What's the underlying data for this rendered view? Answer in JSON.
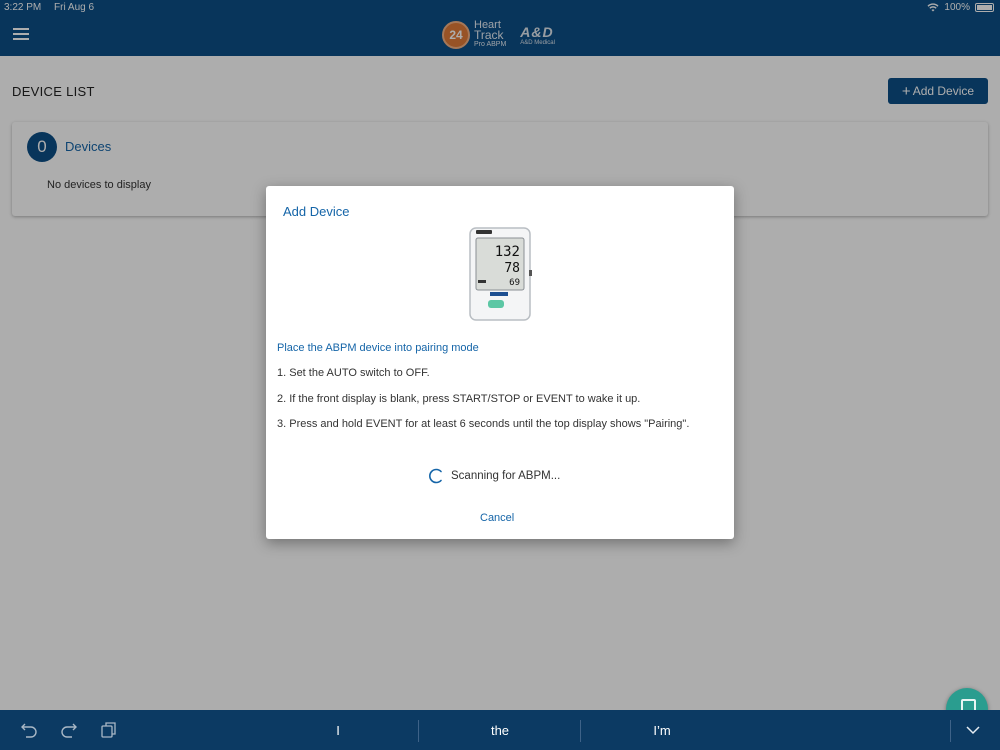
{
  "status_bar": {
    "time": "3:22 PM",
    "date": "Fri Aug 6",
    "battery": "100%"
  },
  "header": {
    "logo_number": "24",
    "logo_line1": "Heart",
    "logo_line2": "Track",
    "logo_line3": "Pro ABPM",
    "brand": "A&D",
    "brand_sub": "A&D Medical"
  },
  "page": {
    "title": "DEVICE LIST",
    "add_button": "Add Device",
    "device_count": "0",
    "devices_label": "Devices",
    "empty_message": "No devices to display"
  },
  "modal": {
    "title": "Add Device",
    "heading": "Place the ABPM device into pairing mode",
    "steps": [
      "1. Set the AUTO switch to OFF.",
      "2. If the front display is blank, press START/STOP or EVENT to wake it up.",
      "3. Press and hold EVENT for at least 6 seconds until the top display shows \"Pairing\"."
    ],
    "device_display": {
      "sys": "132",
      "dia": "78",
      "pulse": "69"
    },
    "scanning_text": "Scanning for ABPM...",
    "cancel_label": "Cancel"
  },
  "keyboard": {
    "suggestions": [
      "I",
      "the",
      "I’m"
    ]
  },
  "colors": {
    "primary": "#0d4f87",
    "link": "#1565a8",
    "accent": "#e07b39"
  }
}
